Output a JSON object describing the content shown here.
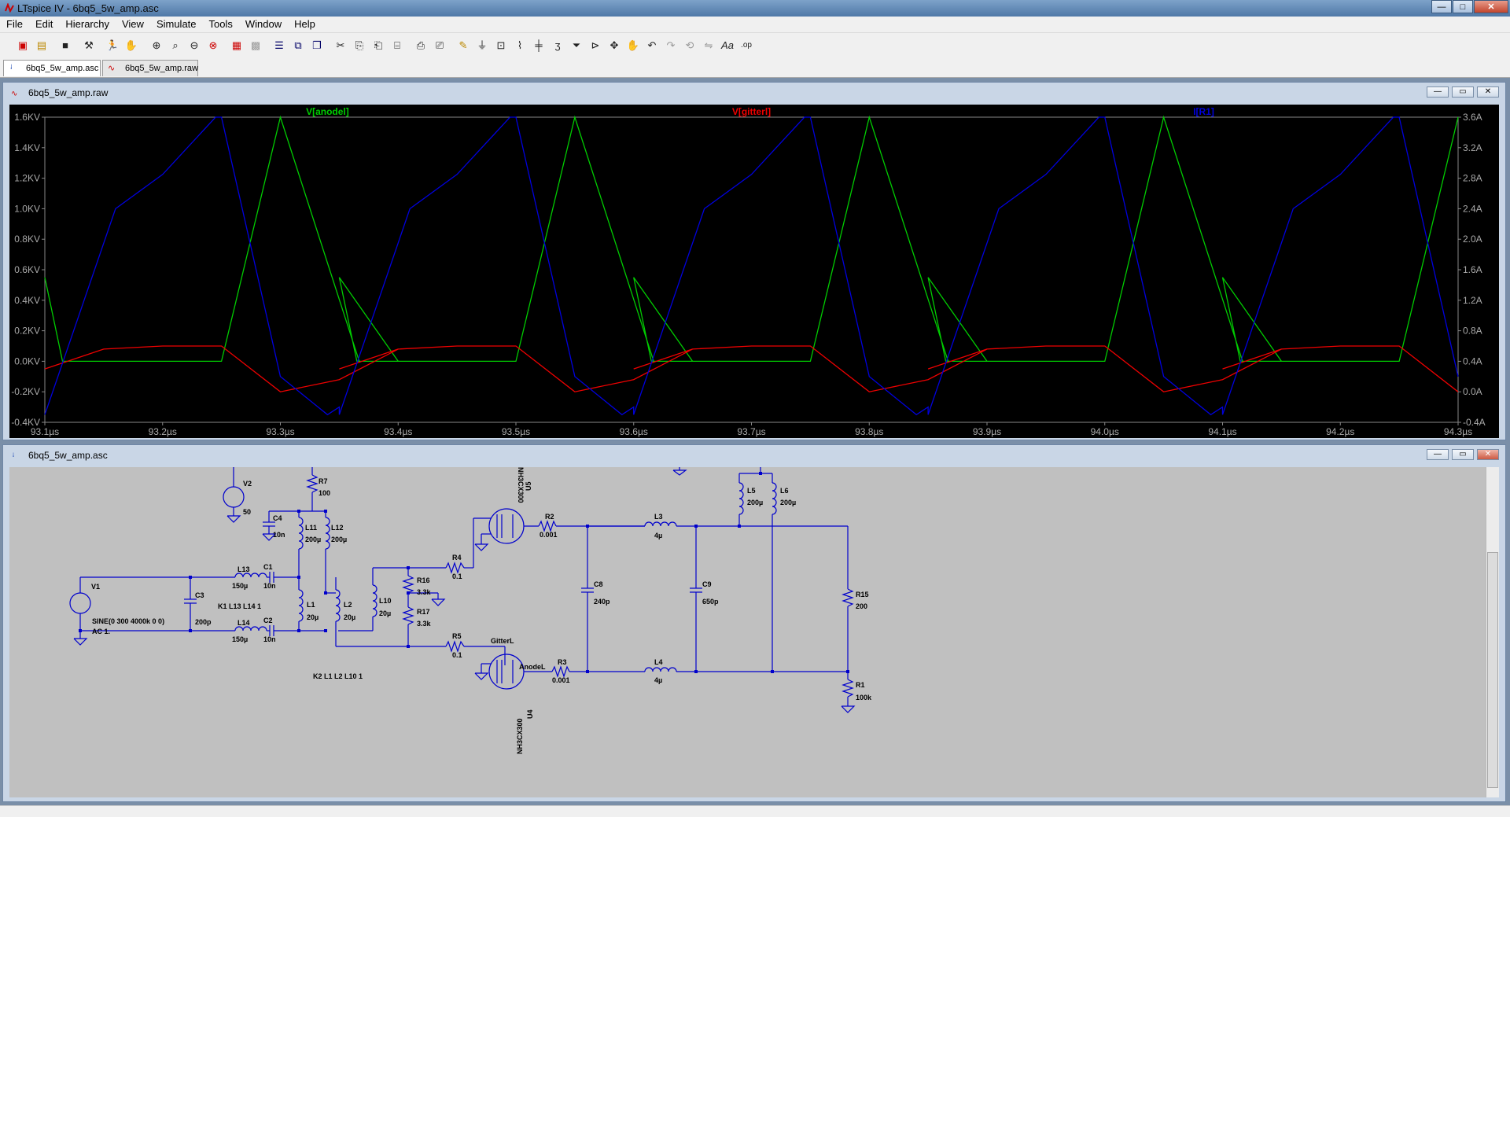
{
  "app": {
    "title": "LTspice IV - 6bq5_5w_amp.asc",
    "controls": {
      "minimize": "—",
      "maximize": "□",
      "close": "✕"
    }
  },
  "menu": [
    "File",
    "Edit",
    "Hierarchy",
    "View",
    "Simulate",
    "Tools",
    "Window",
    "Help"
  ],
  "tabs": [
    {
      "label": "6bq5_5w_amp.asc",
      "icon": "schematic-icon",
      "active": true
    },
    {
      "label": "6bq5_5w_amp.raw",
      "icon": "waveform-icon",
      "active": false
    }
  ],
  "plot_window": {
    "title": "6bq5_5w_amp.raw",
    "controls": {
      "minimize": "—",
      "restore": "▭",
      "close": "✕"
    }
  },
  "schematic_window": {
    "title": "6bq5_5w_amp.asc",
    "controls": {
      "minimize": "—",
      "restore": "▭",
      "close": "✕"
    }
  },
  "chart_data": {
    "type": "line",
    "x_ticks": [
      "93.1µs",
      "93.2µs",
      "93.3µs",
      "93.4µs",
      "93.5µs",
      "93.6µs",
      "93.7µs",
      "93.8µs",
      "93.9µs",
      "94.0µs",
      "94.1µs",
      "94.2µs",
      "94.3µs"
    ],
    "xlim": [
      93.1,
      94.3
    ],
    "left_axis": {
      "ticks": [
        "1.6KV",
        "1.4KV",
        "1.2KV",
        "1.0KV",
        "0.8KV",
        "0.6KV",
        "0.4KV",
        "0.2KV",
        "0.0KV",
        "-0.2KV",
        "-0.4KV"
      ],
      "ylim": [
        -0.4,
        1.6
      ]
    },
    "right_axis": {
      "ticks": [
        "3.6A",
        "3.2A",
        "2.8A",
        "2.4A",
        "2.0A",
        "1.6A",
        "1.2A",
        "0.8A",
        "0.4A",
        "0.0A",
        "-0.4A"
      ],
      "ylim": [
        -0.4,
        3.6
      ]
    },
    "grid": false,
    "period_us": 0.25,
    "series": [
      {
        "name": "V[anodel]",
        "color": "#00cc00",
        "axis": "left",
        "x": [
          93.1,
          93.115,
          93.25,
          93.3,
          93.367,
          93.4
        ],
        "values": [
          0.55,
          0.0,
          0.0,
          1.6,
          0.0,
          0.0
        ]
      },
      {
        "name": "V[gitterl]",
        "color": "#ee0000",
        "axis": "left",
        "x": [
          93.1,
          93.15,
          93.2,
          93.25,
          93.3,
          93.35,
          93.4
        ],
        "values": [
          -0.05,
          0.08,
          0.1,
          0.1,
          -0.2,
          -0.12,
          0.08
        ]
      },
      {
        "name": "I[R1]",
        "color": "#0000dd",
        "axis": "right",
        "x": [
          93.1,
          93.16,
          93.2,
          93.245,
          93.25,
          93.3,
          93.34,
          93.35
        ],
        "values": [
          -0.3,
          2.4,
          2.85,
          3.6,
          3.6,
          0.2,
          -0.3,
          -0.2
        ]
      }
    ]
  },
  "schematic": {
    "labels": [
      "V2",
      "50",
      "R7",
      "100",
      "C4",
      "10n",
      "L11",
      "200µ",
      "L12",
      "200µ",
      "V1",
      "C3",
      "200p",
      "L13",
      "150µ",
      "C1",
      "10n",
      "K1 L13 L14 1",
      "L1",
      "20µ",
      "L2",
      "20µ",
      "L10",
      "20µ",
      "L14",
      "150µ",
      "C2",
      "10n",
      "SINE(0 300 4000k 0 0)",
      "AC 1.",
      "R16",
      "3.3k",
      "R17",
      "3.3k",
      "R4",
      "0.1",
      "R5",
      "0.1",
      "K2 L1 L2 L10 1",
      "R2",
      "0.001",
      "R3",
      "0.001",
      "NH3CX300",
      "U5",
      "NH3CX300",
      "U4",
      "GitterL",
      "AnodeL",
      "C8",
      "240p",
      "C9",
      "650p",
      "L3",
      "4µ",
      "L4",
      "4µ",
      "L5",
      "200µ",
      "L6",
      "200µ",
      "R15",
      "200",
      "R1",
      "100k"
    ]
  }
}
